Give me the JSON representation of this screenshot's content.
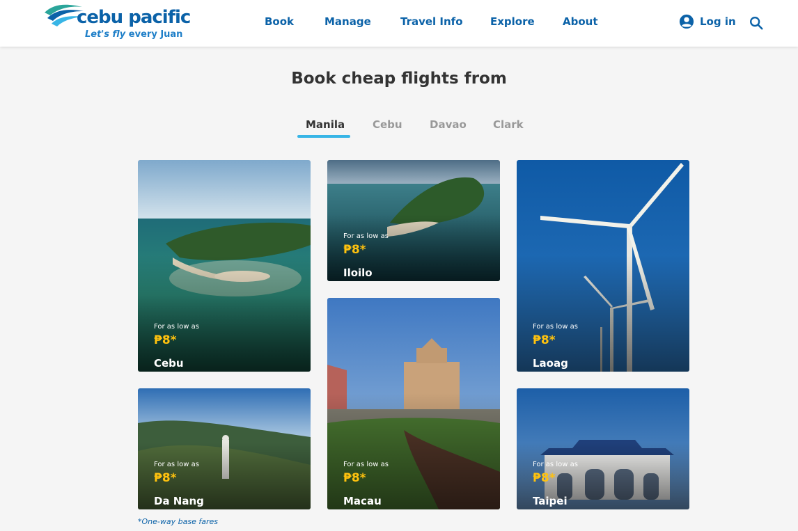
{
  "brand": {
    "name": "cebu pacific",
    "tagline_pre": "Let's fly",
    "tagline_post": "every Juan"
  },
  "nav": {
    "items": [
      {
        "label": "Book"
      },
      {
        "label": "Manage"
      },
      {
        "label": "Travel Info"
      },
      {
        "label": "Explore"
      },
      {
        "label": "About"
      }
    ],
    "login_label": "Log in"
  },
  "section": {
    "title": "Book cheap flights from",
    "tabs": [
      {
        "label": "Manila",
        "active": true
      },
      {
        "label": "Cebu",
        "active": false
      },
      {
        "label": "Davao",
        "active": false
      },
      {
        "label": "Clark",
        "active": false
      }
    ]
  },
  "destinations": [
    {
      "city": "Cebu",
      "low_label": "For as low as",
      "price": "₱8*"
    },
    {
      "city": "Iloilo",
      "low_label": "For as low as",
      "price": "₱8*"
    },
    {
      "city": "Laoag",
      "low_label": "For as low as",
      "price": "₱8*"
    },
    {
      "city": "Da Nang",
      "low_label": "For as low as",
      "price": "₱8*"
    },
    {
      "city": "Macau",
      "low_label": "For as low as",
      "price": "₱8*"
    },
    {
      "city": "Taipei",
      "low_label": "For as low as",
      "price": "₱8*"
    }
  ],
  "footnote": "*One-way base fares",
  "colors": {
    "brand_blue": "#0b62a8",
    "tab_accent": "#38b5e6",
    "price_yellow": "#ffc20e",
    "page_bg": "#f5f5f5"
  },
  "icons": {
    "login": "user-circle-icon",
    "search": "search-icon",
    "logo": "wing-swoosh-icon"
  }
}
